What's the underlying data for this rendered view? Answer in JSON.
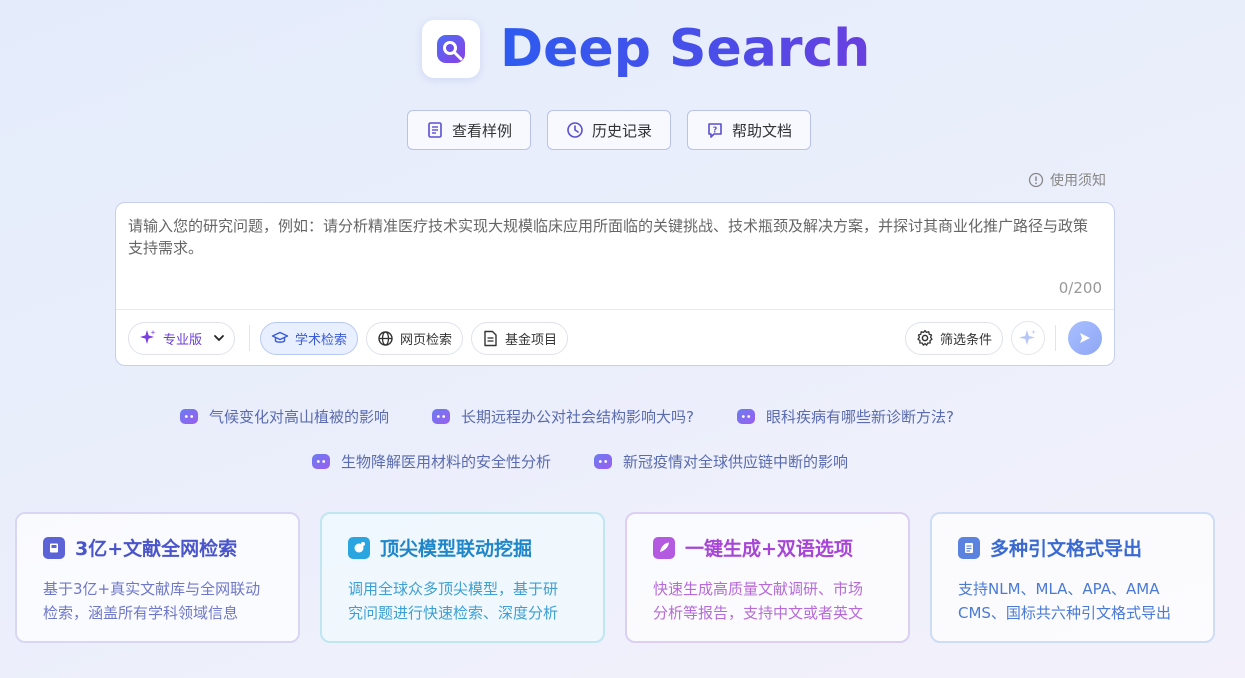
{
  "app": {
    "title": "Deep Search"
  },
  "top_buttons": [
    {
      "label": "查看样例",
      "icon": "document-icon"
    },
    {
      "label": "历史记录",
      "icon": "clock-icon"
    },
    {
      "label": "帮助文档",
      "icon": "help-icon"
    }
  ],
  "notice": {
    "label": "使用须知"
  },
  "input": {
    "placeholder": "请输入您的研究问题，例如：请分析精准医疗技术实现大规模临床应用所面临的关键挑战、技术瓶颈及解决方案，并探讨其商业化推广路径与政策支持需求。",
    "counter": "0/200"
  },
  "toolbar": {
    "mode_label": "专业版",
    "sources": [
      {
        "label": "学术检索",
        "active": true
      },
      {
        "label": "网页检索",
        "active": false
      },
      {
        "label": "基金项目",
        "active": false
      }
    ],
    "filter_label": "筛选条件"
  },
  "suggestions": {
    "row1": [
      "气候变化对高山植被的影响",
      "长期远程办公对社会结构影响大吗?",
      "眼科疾病有哪些新诊断方法?"
    ],
    "row2": [
      "生物降解医用材料的安全性分析",
      "新冠疫情对全球供应链中断的影响"
    ]
  },
  "features": [
    {
      "title": "3亿+文献全网检索",
      "line1": "基于3亿+真实文献库与全网联动",
      "line2": "检索，涵盖所有学科领域信息"
    },
    {
      "title": "顶尖模型联动挖掘",
      "line1": "调用全球众多顶尖模型，基于研",
      "line2": "究问题进行快速检索、深度分析"
    },
    {
      "title": "一键生成+双语选项",
      "line1": "快速生成高质量文献调研、市场",
      "line2": "分析等报告，支持中文或者英文"
    },
    {
      "title": "多种引文格式导出",
      "line1": "支持NLM、MLA、APA、AMA",
      "line2": "CMS、国标共六种引文格式导出"
    }
  ]
}
